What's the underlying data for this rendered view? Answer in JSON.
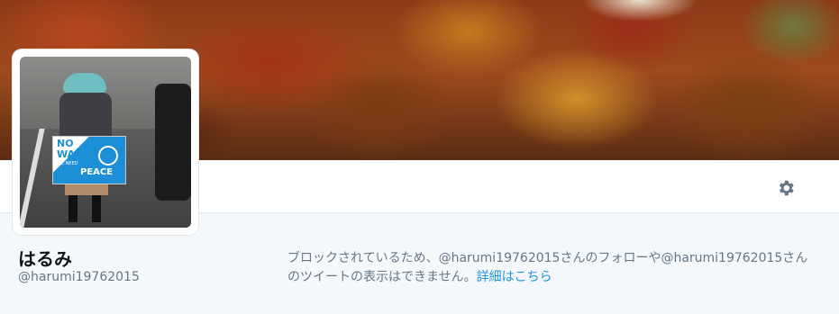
{
  "profile": {
    "display_name": "はるみ",
    "handle": "@harumi19762015",
    "avatar_sign": {
      "line1": "NO",
      "line2": "WAR",
      "line3": "WE NEED",
      "line4": "PEACE",
      "small": "JUST"
    }
  },
  "notice": {
    "text": "ブロックされているため、@harumi19762015さんのフォローや@harumi19762015さんのツイートの表示はできません。",
    "link_label": "詳細はこちら"
  },
  "toolbar": {
    "settings_icon": "gear-icon"
  },
  "colors": {
    "link": "#1b95e0",
    "muted": "#657786",
    "icon": "#657786",
    "background": "#f5f8fa"
  }
}
